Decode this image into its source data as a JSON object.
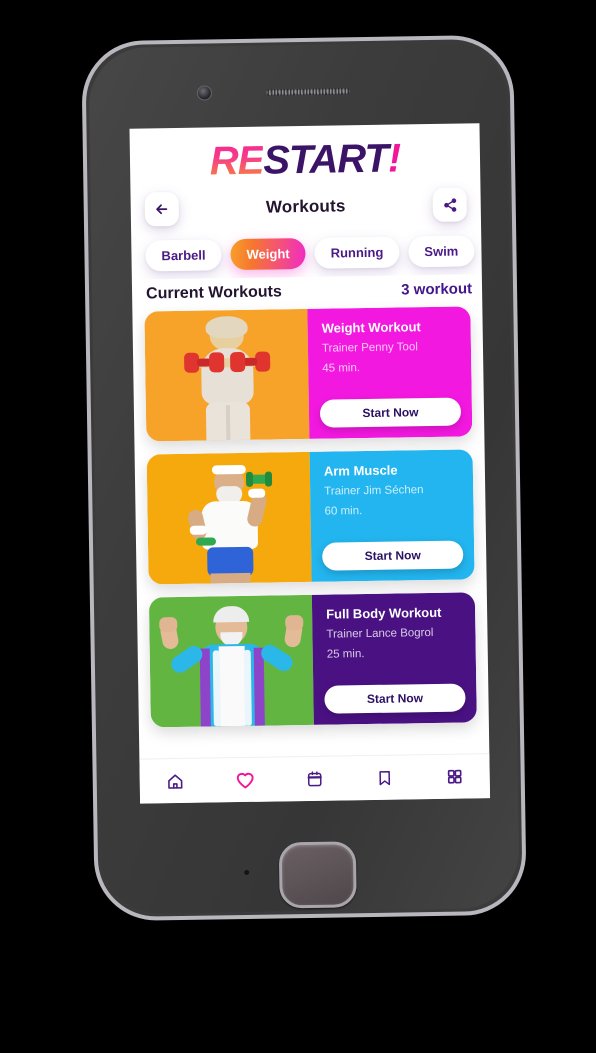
{
  "app": {
    "logo": {
      "part1": "RE",
      "part2": "START",
      "part3": "!"
    },
    "back_icon": "arrow-left-icon",
    "share_icon": "share-icon",
    "page_title": "Workouts"
  },
  "filters": {
    "chips": [
      {
        "label": "Barbell",
        "active": false
      },
      {
        "label": "Weight",
        "active": true
      },
      {
        "label": "Running",
        "active": false
      },
      {
        "label": "Swim",
        "active": false
      }
    ]
  },
  "section": {
    "title": "Current Workouts",
    "count_label": "3 workout"
  },
  "workouts": [
    {
      "title": "Weight Workout",
      "trainer": "Trainer Penny Tool",
      "duration": "45 min.",
      "button": "Start Now",
      "panel_color": "#f318e0",
      "photo_bg": "#f7a329"
    },
    {
      "title": "Arm Muscle",
      "trainer": "Trainer Jim Séchen",
      "duration": "60 min.",
      "button": "Start Now",
      "panel_color": "#22b5ef",
      "photo_bg": "#f5a90c"
    },
    {
      "title": "Full Body Workout",
      "trainer": "Trainer Lance Bogrol",
      "duration": "25 min.",
      "button": "Start Now",
      "panel_color": "#4a1183",
      "photo_bg": "#63b541"
    }
  ],
  "tabbar": {
    "items": [
      {
        "icon": "home-icon",
        "active": false
      },
      {
        "icon": "heart-icon",
        "active": true
      },
      {
        "icon": "calendar-icon",
        "active": false
      },
      {
        "icon": "bookmark-icon",
        "active": false
      },
      {
        "icon": "grid-icon",
        "active": false
      }
    ],
    "active_color": "#f0179b",
    "inactive_color": "#4a1a86"
  },
  "device": {
    "body_color": "#3b3b3b",
    "bezel_color": "#b9b6bd"
  }
}
